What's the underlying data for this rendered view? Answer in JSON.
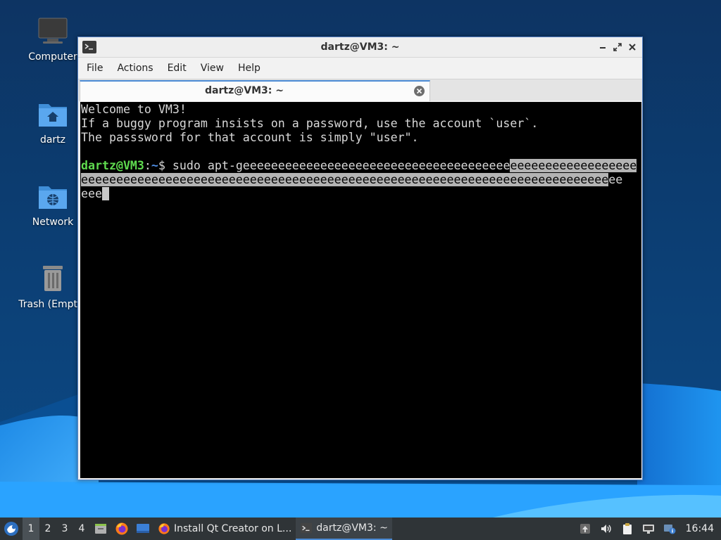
{
  "desktop": {
    "icons": [
      {
        "label": "Computer",
        "icon": "computer-icon"
      },
      {
        "label": "dartz",
        "icon": "home-folder-icon"
      },
      {
        "label": "Network",
        "icon": "network-folder-icon"
      },
      {
        "label": "Trash (Empty)",
        "icon": "trash-icon"
      }
    ]
  },
  "window": {
    "title": "dartz@VM3: ~",
    "controls": [
      "minimize-icon",
      "maximize-icon",
      "close-icon"
    ],
    "menu": [
      "File",
      "Actions",
      "Edit",
      "View",
      "Help"
    ],
    "tab": {
      "label": "dartz@VM3: ~"
    }
  },
  "terminal": {
    "lines": [
      "Welcome to VM3!",
      "If a buggy program insists on a password, use the account `user`.",
      "The passsword for that account is simply \"user\"."
    ],
    "prompt": {
      "user_host": "dartz@VM3",
      "sep": ":",
      "path": "~",
      "symbol": "$ "
    },
    "command": {
      "line1_plain": "sudo apt-geeeeeeeeeeeeeeeeeeeeeeeeeeeeeeeeeeeeee",
      "line1_selected": "eeeeeeeeeeeeeeeeee",
      "line2_selected": "eeeeeeeeeeeeeeeeeeeeeeeeeeeeeeeeeeeeeeeeeeeeeeeeeeeeeeeeeeeeeeeeeeeeeeeeeee",
      "line2_plain": "ee",
      "line3_plain": "eee"
    }
  },
  "taskbar": {
    "workspaces": [
      "1",
      "2",
      "3",
      "4"
    ],
    "active_workspace": "1",
    "tasks": [
      {
        "label": "Install Qt Creator on L...",
        "icon": "firefox-icon"
      },
      {
        "label": "dartz@VM3: ~",
        "icon": "terminal-icon"
      }
    ],
    "clock": "16:44"
  },
  "colors": {
    "accent": "#4a8ad4",
    "prompt_user": "#5fdb4f",
    "prompt_path": "#4f8fe6",
    "selection": "#b4b4b4"
  }
}
